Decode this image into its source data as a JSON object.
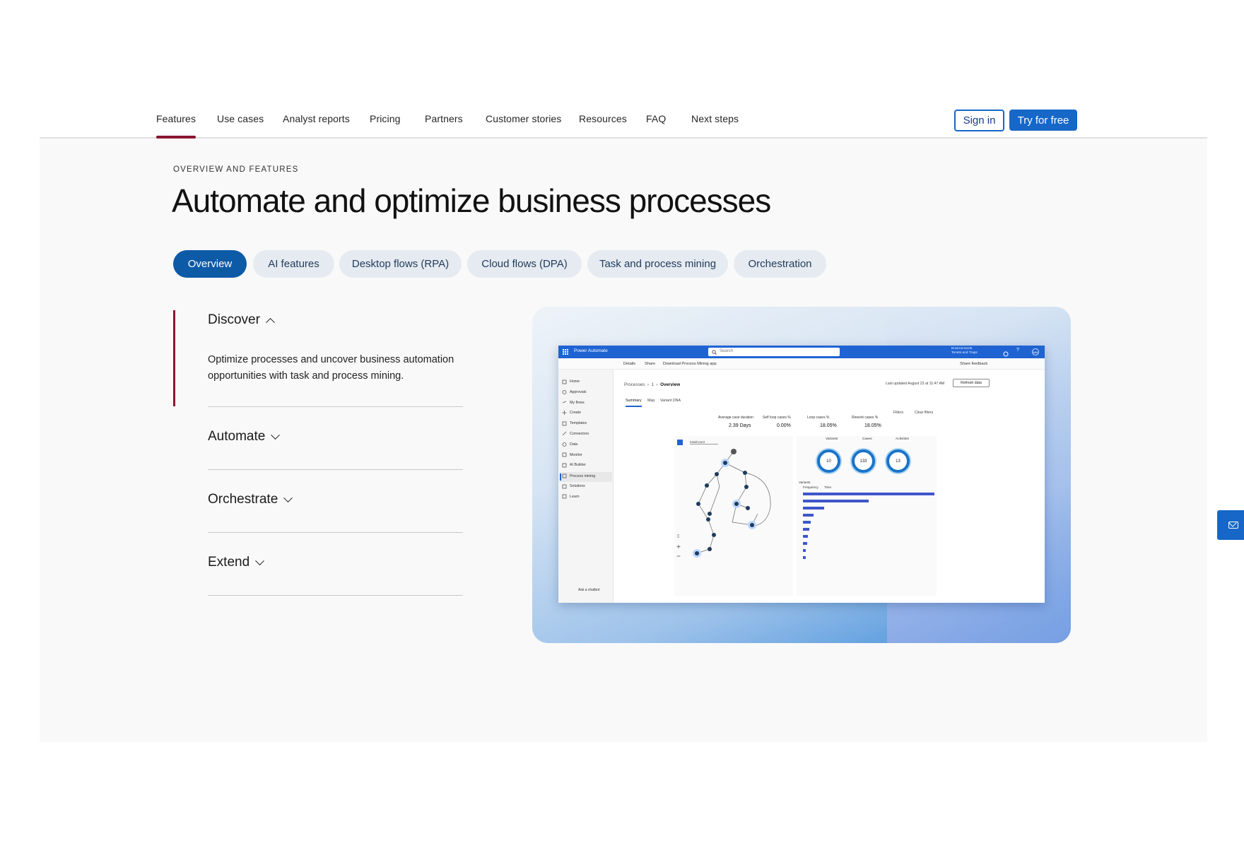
{
  "nav": {
    "tabs": [
      {
        "label": "Features"
      },
      {
        "label": "Use cases"
      },
      {
        "label": "Analyst reports"
      },
      {
        "label": "Pricing"
      },
      {
        "label": "Partners"
      },
      {
        "label": "Customer stories"
      },
      {
        "label": "Resources"
      },
      {
        "label": "FAQ"
      },
      {
        "label": "Next steps"
      }
    ],
    "active_tab": "Features",
    "sign_in": "Sign in",
    "try_free": "Try for free"
  },
  "hero": {
    "eyebrow": "OVERVIEW AND FEATURES",
    "title": "Automate and optimize business processes"
  },
  "pills": [
    "Overview",
    "AI features",
    "Desktop flows (RPA)",
    "Cloud flows (DPA)",
    "Task and process mining",
    "Orchestration"
  ],
  "active_pill": "Overview",
  "accordion": {
    "items": [
      {
        "title": "Discover",
        "expanded": true,
        "body": "Optimize processes and uncover business automation opportunities with task and process mining."
      },
      {
        "title": "Automate",
        "expanded": false
      },
      {
        "title": "Orchestrate",
        "expanded": false
      },
      {
        "title": "Extend",
        "expanded": false
      }
    ]
  },
  "app": {
    "brand": "Power Automate",
    "search_placeholder": "Search",
    "env_label": "Environments",
    "env_value": "Tenets and Traps",
    "avatar": "MM",
    "commands": [
      "Details",
      "Share",
      "Download Process Mining app"
    ],
    "share_feedback": "Share feedback",
    "sidebar": [
      "Home",
      "Approvals",
      "My flows",
      "Create",
      "Templates",
      "Connectors",
      "Data",
      "Monitor",
      "AI Builder",
      "Process mining",
      "Solutions",
      "Learn"
    ],
    "sidebar_selected": "Process mining",
    "chatbot": "Ask a chatbot",
    "breadcrumb": {
      "root": "Processes",
      "mid": "1",
      "current": "Overview"
    },
    "last_updated": "Last updated August 23 at 11:47 AM",
    "refresh": "Refresh data",
    "subtabs": [
      "Summary",
      "Map",
      "Variant DNA"
    ],
    "filters": "Filters",
    "clear_filters": "Clear filters",
    "kpis": [
      {
        "label": "Average case duration",
        "value": "2.39 Days"
      },
      {
        "label": "Self loop cases %",
        "value": "0.00%"
      },
      {
        "label": "Loop cases %",
        "value": "18.05%"
      },
      {
        "label": "Rework cases %",
        "value": "18.05%"
      }
    ],
    "map_dropdown": "totalCount",
    "rings": [
      {
        "label": "Variants",
        "value": "10"
      },
      {
        "label": "Cases",
        "value": "133"
      },
      {
        "label": "Activities",
        "value": "13"
      }
    ],
    "variants_title": "Variants",
    "variants_cols": [
      "Frequency",
      "Time"
    ],
    "variant_bars": [
      1.0,
      0.5,
      0.16,
      0.08,
      0.06,
      0.05,
      0.04,
      0.03,
      0.02,
      0.02
    ],
    "colors": {
      "brand": "#1f63d3",
      "bar": "#3f56c9",
      "ring": "#1a73c9"
    }
  },
  "colors": {
    "accent_red": "#8a1530",
    "primary_blue": "#1767c8",
    "pill_active": "#0d5aa7"
  }
}
